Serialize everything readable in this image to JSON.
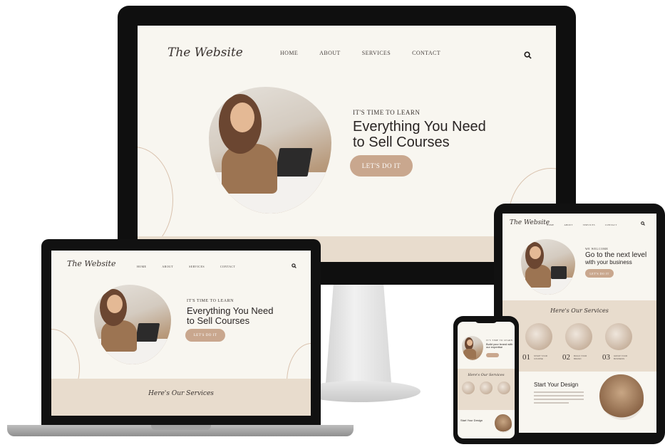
{
  "site": {
    "logo_text": "The Website",
    "nav": [
      "HOME",
      "ABOUT",
      "SERVICES",
      "CONTACT"
    ],
    "kicker": "IT'S TIME TO LEARN",
    "headline_line1": "Everything You Need",
    "headline_line2": "to Sell Courses",
    "cta_label": "LET'S DO IT",
    "services_title": "Here's Our Services"
  },
  "tablet": {
    "kicker": "WE WELCOME",
    "headline_line1": "Go to the next level",
    "headline_line2": "with your business",
    "cta_label": "LET'S DO IT",
    "services_title": "Here's Our Services",
    "services": [
      {
        "num": "01",
        "label": "START YOUR COURSE"
      },
      {
        "num": "02",
        "label": "BUILD YOUR BRAND"
      },
      {
        "num": "03",
        "label": "GROW YOUR BUSINESS"
      }
    ],
    "start_title": "Start Your Design"
  },
  "phone": {
    "kicker": "IT'S TIME TO LEARN",
    "headline": "Build your brand with our expertise",
    "services_title": "Here's Our Services",
    "start_title": "Start Your Design"
  },
  "colors": {
    "cream": "#f8f6f0",
    "beige": "#e8dccd",
    "accent": "#c9a78e",
    "frame": "#0f0f0f"
  },
  "icons": {
    "search": "search-icon"
  }
}
